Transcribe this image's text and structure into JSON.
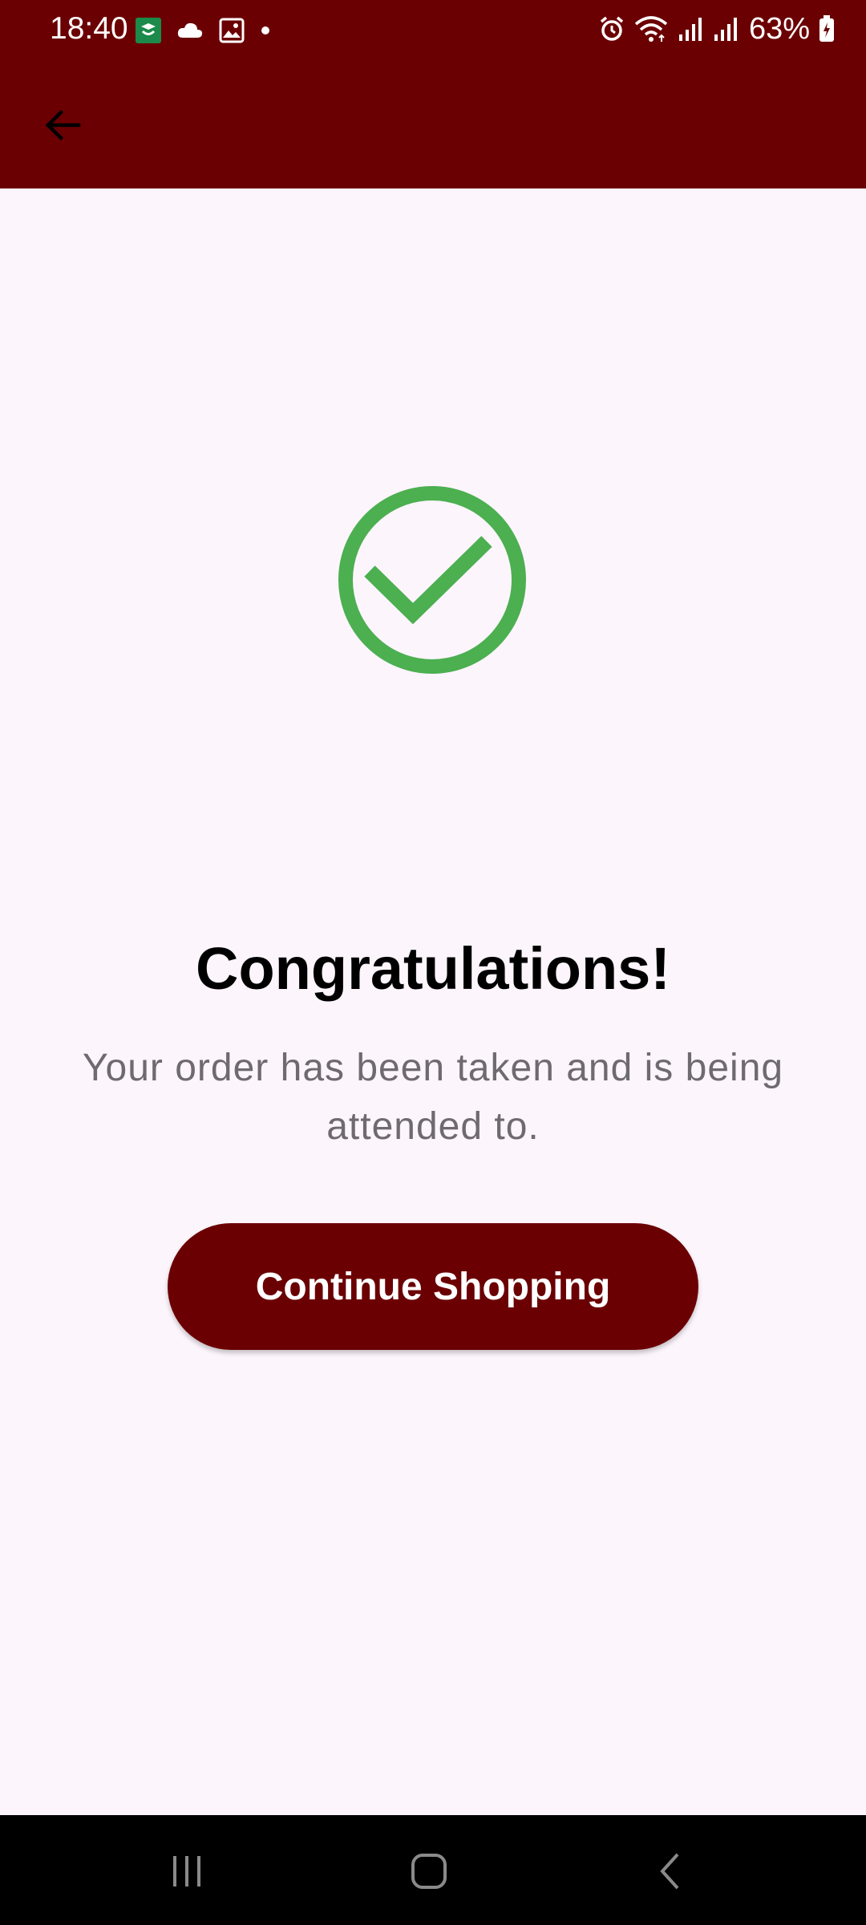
{
  "status_bar": {
    "time": "18:40",
    "battery_percent": "63%",
    "left_icons": [
      "app-notification-icon",
      "cloud-icon",
      "gallery-icon",
      "dot-icon"
    ],
    "right_icons": [
      "alarm-icon",
      "wifi-icon",
      "signal-icon",
      "signal-icon",
      "battery-charging-icon"
    ]
  },
  "app_bar": {
    "back_icon": "arrow-left-icon",
    "color": "#6b0003"
  },
  "main": {
    "status_icon": "check-circle-icon",
    "status_color": "#4caf50",
    "title": "Congratulations!",
    "message": "Your order has been taken and is being attended to.",
    "button_label": "Continue Shopping"
  },
  "nav_bar": {
    "buttons": [
      "recent-apps-icon",
      "home-icon",
      "back-icon"
    ]
  }
}
